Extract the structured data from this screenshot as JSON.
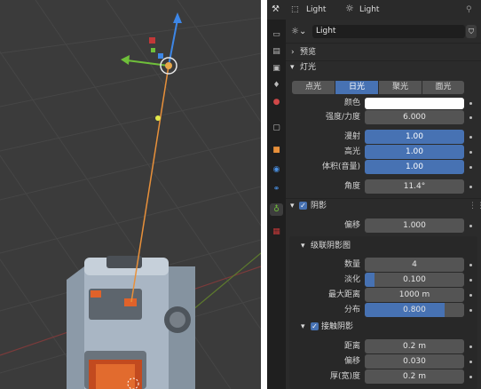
{
  "header": {
    "object_name": "Light",
    "data_name": "Light",
    "datablock_name": "Light",
    "pin_icon": "pin-icon"
  },
  "tabs": [
    {
      "icon": "tool-icon"
    },
    {
      "icon": "render-icon"
    },
    {
      "icon": "output-icon"
    },
    {
      "icon": "view-layer-icon"
    },
    {
      "icon": "scene-icon"
    },
    {
      "icon": "world-icon"
    },
    {
      "icon": "collection-icon"
    },
    {
      "icon": "object-icon"
    },
    {
      "icon": "physics-icon"
    },
    {
      "icon": "constraints-icon"
    },
    {
      "icon": "light-data-icon",
      "active": true
    },
    {
      "icon": "texture-icon"
    }
  ],
  "preview": {
    "title": "预览"
  },
  "light": {
    "title": "灯光",
    "types": [
      "点光",
      "日光",
      "聚光",
      "面光"
    ],
    "selected_type": 1,
    "color_label": "颜色",
    "color_value": "#ffffff",
    "strength_label": "强度/力度",
    "strength_value": "6.000",
    "diffuse_label": "漫射",
    "diffuse_value": "1.00",
    "specular_label": "高光",
    "specular_value": "1.00",
    "volume_label": "体积(音量)",
    "volume_value": "1.00",
    "angle_label": "角度",
    "angle_value": "11.4°"
  },
  "shadow": {
    "title": "阴影",
    "enabled": true,
    "bias_label": "偏移",
    "bias_value": "1.000"
  },
  "cascaded": {
    "title": "级联阴影图",
    "count_label": "数量",
    "count_value": "4",
    "fade_label": "淡化",
    "fade_value": "0.100",
    "fade_fraction": 0.1,
    "max_distance_label": "最大距离",
    "max_distance_value": "1000 m",
    "distribution_label": "分布",
    "distribution_value": "0.800",
    "distribution_fraction": 0.8
  },
  "contact": {
    "title": "接触阴影",
    "enabled": true,
    "distance_label": "距离",
    "distance_value": "0.2 m",
    "bias_label": "偏移",
    "bias_value": "0.030",
    "thickness_label": "厚(宽)度",
    "thickness_value": "0.2 m"
  }
}
